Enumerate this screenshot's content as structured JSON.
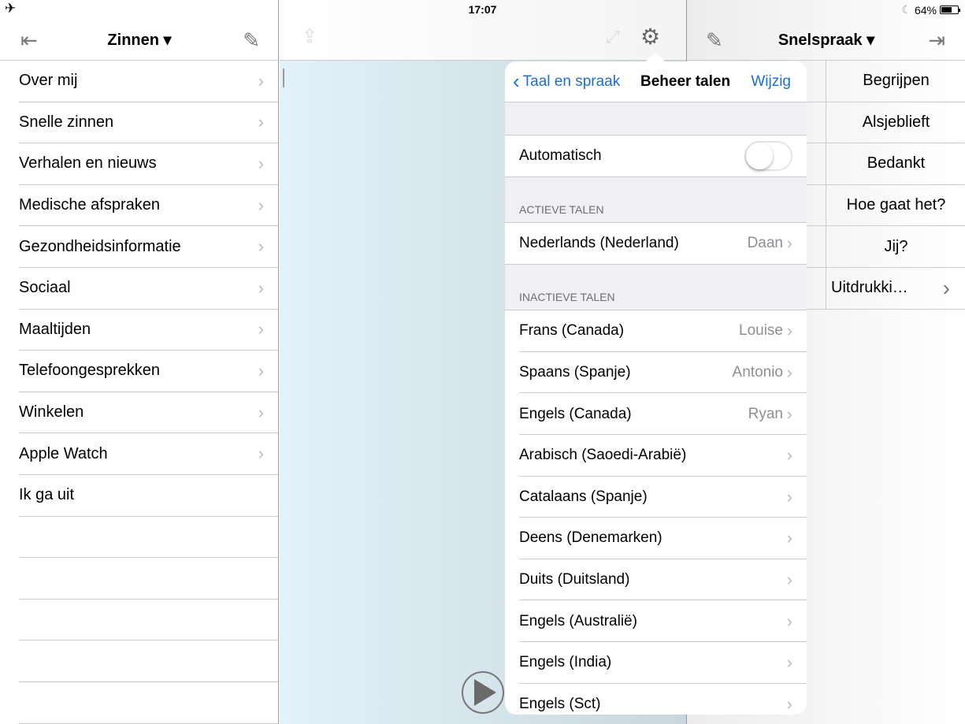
{
  "status": {
    "time": "17:07",
    "battery": "64%",
    "battery_level": 0.64
  },
  "left": {
    "title": "Zinnen ▾",
    "items": [
      "Over mij",
      "Snelle zinnen",
      "Verhalen en nieuws",
      "Medische afspraken",
      "Gezondheidsinformatie",
      "Sociaal",
      "Maaltijden",
      "Telefoongesprekken",
      "Winkelen",
      "Apple Watch",
      "Ik ga uit"
    ]
  },
  "right": {
    "title": "Snelspraak ▾",
    "items": [
      "Begrijpen",
      "Alsjeblieft",
      "Bedankt",
      "Hoe gaat het?",
      "Jij?",
      "Uitdrukki…"
    ]
  },
  "popover": {
    "back": "Taal en spraak",
    "title": "Beheer talen",
    "edit": "Wijzig",
    "auto_label": "Automatisch",
    "auto_on": false,
    "active_header": "ACTIEVE TALEN",
    "active": [
      {
        "name": "Nederlands (Nederland)",
        "voice": "Daan"
      }
    ],
    "inactive_header": "INACTIEVE TALEN",
    "inactive": [
      {
        "name": "Frans (Canada)",
        "voice": "Louise"
      },
      {
        "name": "Spaans (Spanje)",
        "voice": "Antonio"
      },
      {
        "name": "Engels (Canada)",
        "voice": "Ryan"
      },
      {
        "name": "Arabisch (Saoedi-Arabië)",
        "voice": ""
      },
      {
        "name": "Catalaans (Spanje)",
        "voice": ""
      },
      {
        "name": "Deens (Denemarken)",
        "voice": ""
      },
      {
        "name": "Duits (Duitsland)",
        "voice": ""
      },
      {
        "name": "Engels (Australië)",
        "voice": ""
      },
      {
        "name": "Engels (India)",
        "voice": ""
      },
      {
        "name": "Engels (Sct)",
        "voice": ""
      }
    ]
  },
  "accent": "#1a6fd6"
}
